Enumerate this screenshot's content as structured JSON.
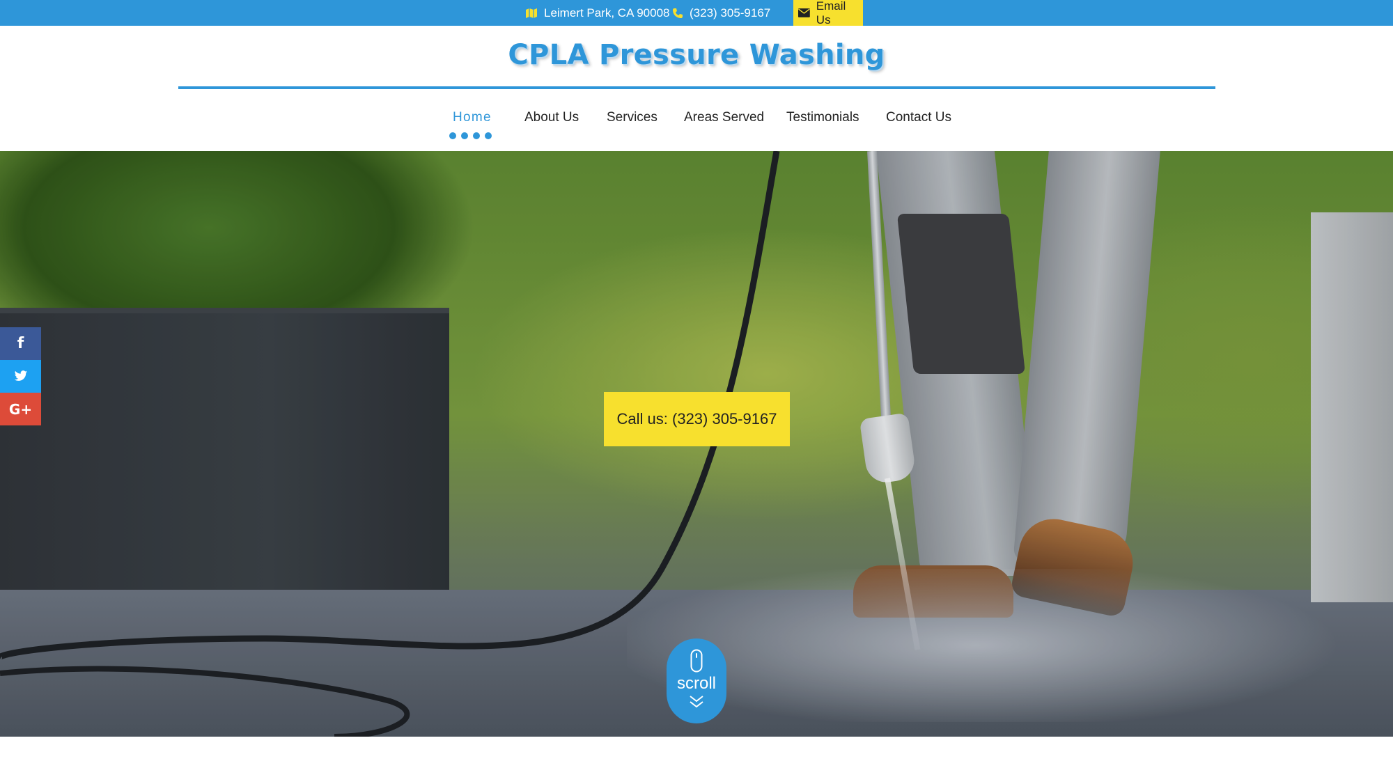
{
  "topbar": {
    "address": "Leimert Park, CA 90008",
    "phone": "(323) 305-9167",
    "email_label": "Email Us",
    "icons": {
      "address": "map-icon",
      "phone": "phone-icon",
      "email": "envelope-icon"
    }
  },
  "header": {
    "logo": "CPLA Pressure Washing"
  },
  "nav": {
    "items": [
      {
        "label": "Home",
        "active": true
      },
      {
        "label": "About Us"
      },
      {
        "label": "Services"
      },
      {
        "label": "Areas Served"
      },
      {
        "label": "Testimonials"
      },
      {
        "label": "Contact Us"
      }
    ]
  },
  "hero": {
    "cta_label": "Call us: (323) 305-9167",
    "scroll_label": "scroll"
  },
  "social": {
    "facebook": "f",
    "google_plus": "G+"
  },
  "colors": {
    "primary": "#2e96d9",
    "accent": "#f7e02e",
    "facebook": "#3b5998",
    "twitter": "#1da1f2",
    "google_plus": "#dd4b39"
  }
}
